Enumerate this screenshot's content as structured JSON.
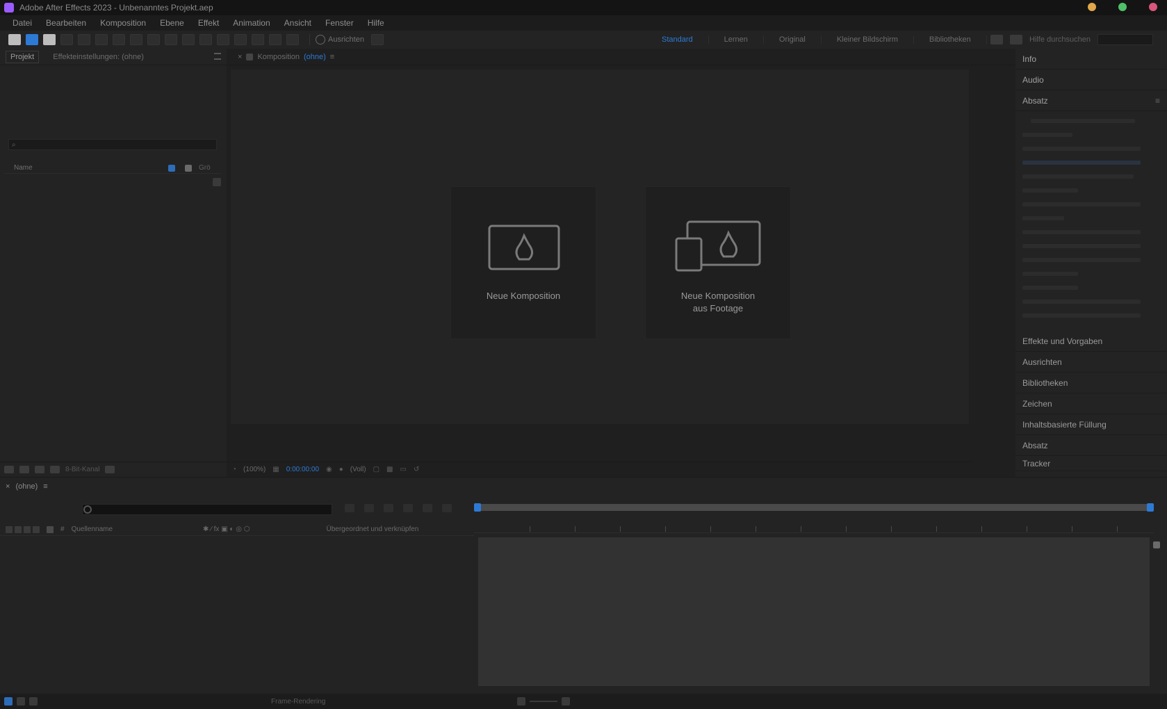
{
  "titlebar": {
    "title": "Adobe After Effects 2023 - Unbenanntes Projekt.aep",
    "controls": {
      "minimize_color": "#e0a84a",
      "maximize_color": "#4fc06a",
      "close_color": "#d9567c"
    }
  },
  "menu": [
    "Datei",
    "Bearbeiten",
    "Komposition",
    "Ebene",
    "Effekt",
    "Animation",
    "Ansicht",
    "Fenster",
    "Hilfe"
  ],
  "toolbar": {
    "snap_label": "Ausrichten",
    "workspaces": [
      "Standard",
      "Lernen",
      "Original",
      "Kleiner Bildschirm",
      "Bibliotheken"
    ],
    "active_workspace": "Standard",
    "help_label": "Hilfe durchsuchen"
  },
  "project_panel": {
    "tabs": [
      "Projekt",
      "Effekteinstellungen: (ohne)"
    ],
    "search_placeholder": "",
    "col_name": "Name",
    "col_size": "Grö",
    "footer_depth": "8-Bit-Kanal"
  },
  "composition_panel": {
    "tab_label": "Komposition",
    "tab_value": "(ohne)",
    "card_new": "Neue Komposition",
    "card_from_footage_l1": "Neue Komposition",
    "card_from_footage_l2": "aus Footage",
    "footer": {
      "zoom": "(100%)",
      "time": "0:00:00:00",
      "resolution": "(Voll)"
    }
  },
  "right_panel": {
    "top_sections": [
      "Info",
      "Audio"
    ],
    "paragraph_title": "Absatz",
    "sections": [
      "Effekte und Vorgaben",
      "Ausrichten",
      "Bibliotheken",
      "Zeichen",
      "Inhaltsbasierte Füllung",
      "Absatz",
      "Tracker"
    ]
  },
  "timeline": {
    "tab": "(ohne)",
    "col_source": "Quellenname",
    "col_parent": "Übergeordnet und verknüpfen"
  },
  "statusbar": {
    "center": "Frame-Rendering"
  },
  "colors": {
    "accent": "#2d7ad6",
    "bg": "#1d1d1d",
    "panel": "#232323"
  }
}
